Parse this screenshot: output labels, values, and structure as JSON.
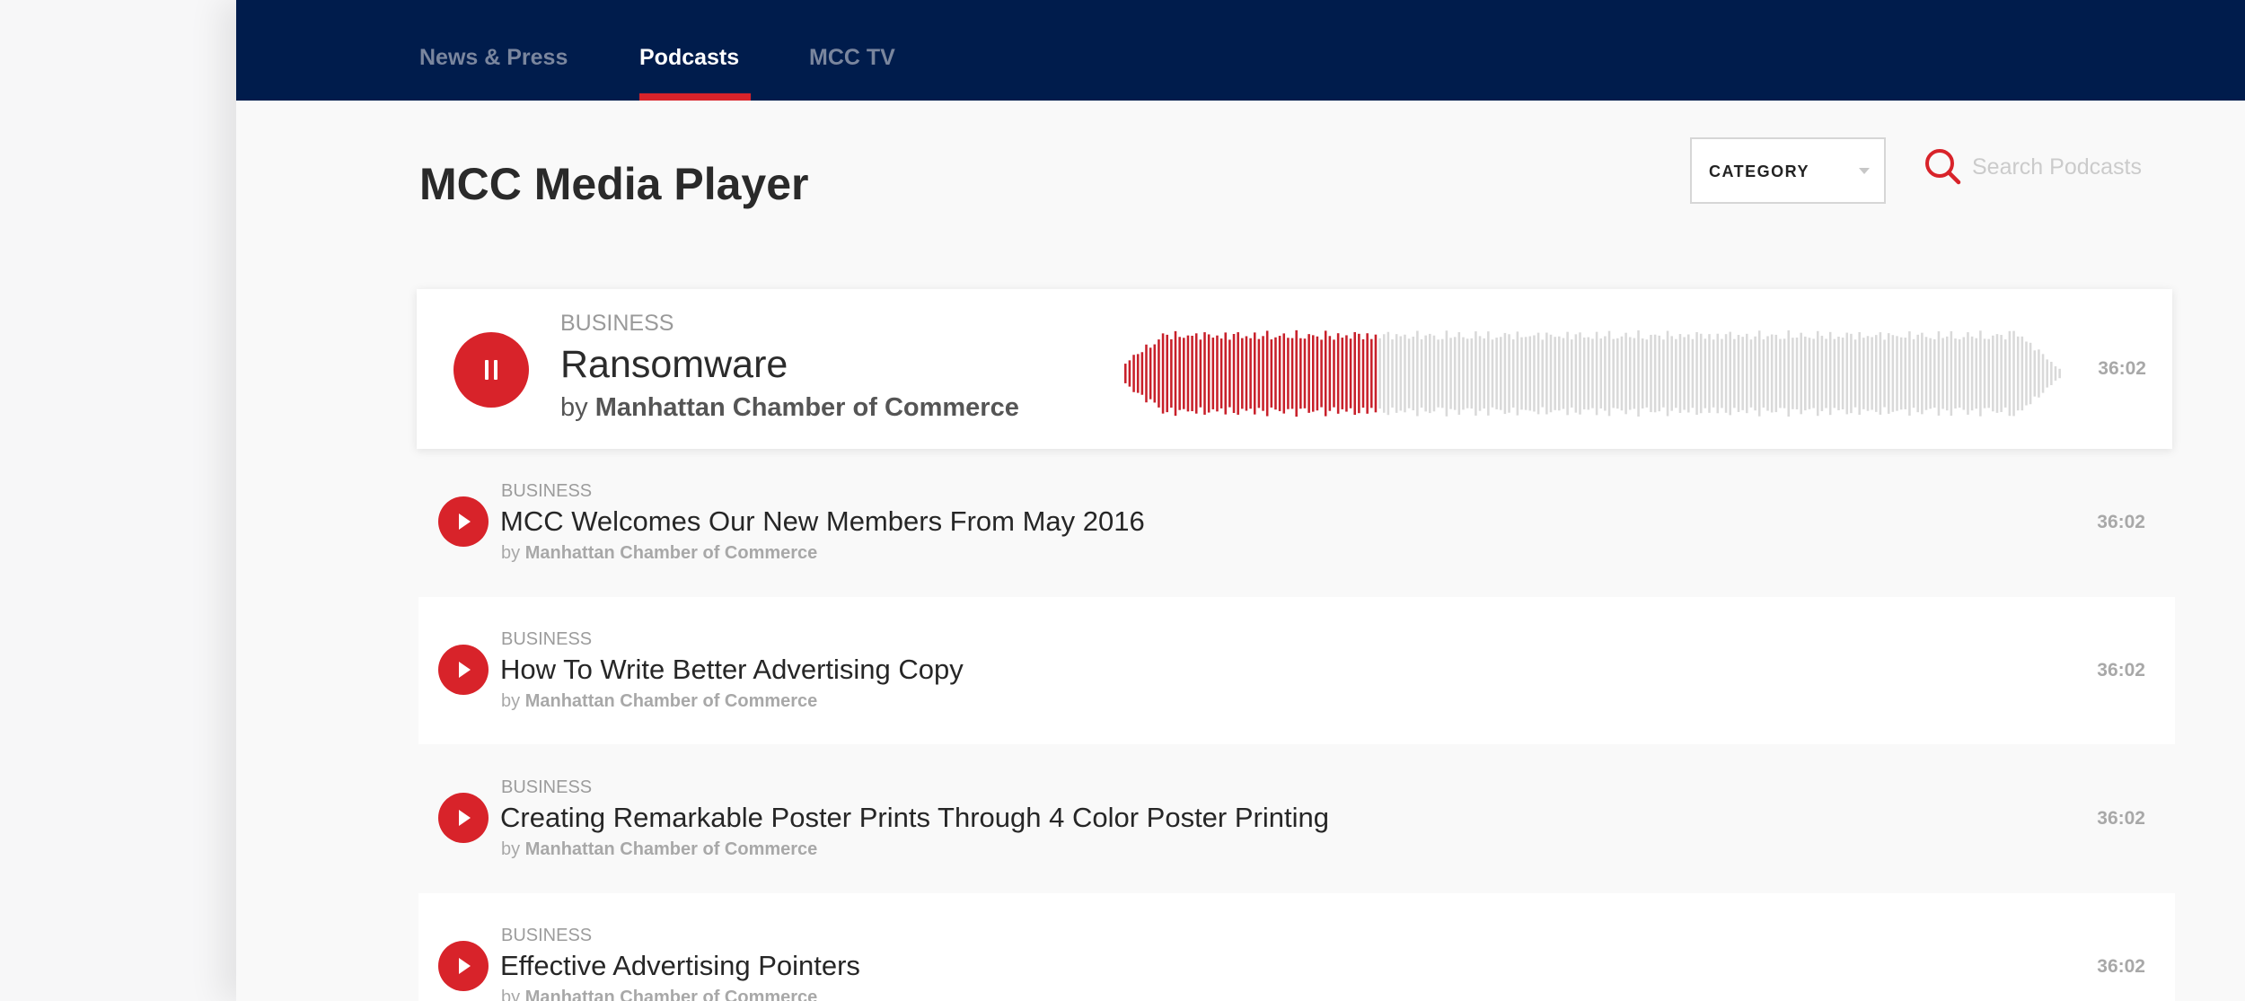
{
  "nav": {
    "tabs": [
      {
        "label": "News & Press",
        "active": false
      },
      {
        "label": "Podcasts",
        "active": true
      },
      {
        "label": "MCC TV",
        "active": false
      }
    ]
  },
  "page": {
    "title": "MCC Media Player"
  },
  "filters": {
    "category_label": "CATEGORY",
    "search_placeholder": "Search Podcasts"
  },
  "now_playing": {
    "category": "BUSINESS",
    "title": "Ransomware",
    "by_prefix": "by",
    "author": "Manhattan Chamber of Commerce",
    "duration": "36:02",
    "state": "playing",
    "progress": 0.27
  },
  "episodes": [
    {
      "category": "BUSINESS",
      "title": "MCC Welcomes Our New Members From May 2016",
      "by_prefix": "by",
      "author": "Manhattan Chamber of Commerce",
      "duration": "36:02"
    },
    {
      "category": "BUSINESS",
      "title": "How To Write Better Advertising Copy",
      "by_prefix": "by",
      "author": "Manhattan Chamber of Commerce",
      "duration": "36:02"
    },
    {
      "category": "BUSINESS",
      "title": "Creating Remarkable Poster Prints Through 4 Color Poster Printing",
      "by_prefix": "by",
      "author": "Manhattan Chamber of Commerce",
      "duration": "36:02"
    },
    {
      "category": "BUSINESS",
      "title": "Effective Advertising Pointers",
      "by_prefix": "by",
      "author": "Manhattan Chamber of Commerce",
      "duration": "36:02"
    }
  ],
  "colors": {
    "nav_bg": "#001c4c",
    "accent": "#d8232a",
    "wave_played": "#c8202a",
    "wave_unplayed": "#d9d9d9"
  },
  "icons": {
    "search": "search-icon",
    "pause": "pause-icon",
    "play": "play-icon",
    "dropdown": "chevron-down-icon"
  }
}
